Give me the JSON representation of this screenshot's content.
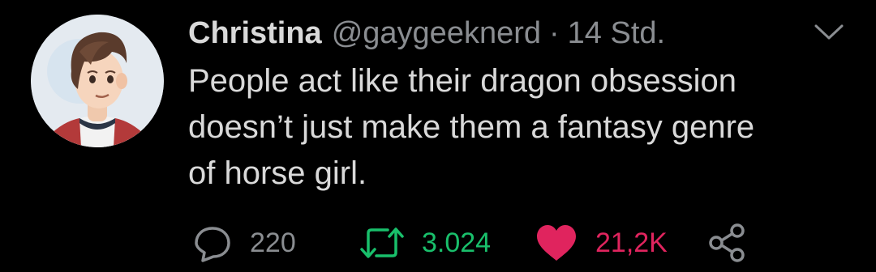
{
  "tweet": {
    "author": {
      "name": "Christina",
      "handle": "@gaygeeknerd"
    },
    "separator": "·",
    "timestamp": "14 Std.",
    "text_lines": [
      "People act like their dragon obsession",
      "doesn’t just make them a fantasy genre",
      "of horse girl."
    ],
    "stats": {
      "replies": "220",
      "retweets": "3.024",
      "likes": "21,2K"
    }
  },
  "icons": {
    "menu": "chevron-down-icon",
    "reply": "speech-bubble-icon",
    "retweet": "retweet-arrows-icon",
    "like": "heart-icon",
    "share": "share-nodes-icon"
  },
  "colors": {
    "background": "#000000",
    "text": "#d9d9d9",
    "muted": "#8a8d91",
    "retweet": "#19bf6b",
    "like": "#e0245e"
  }
}
